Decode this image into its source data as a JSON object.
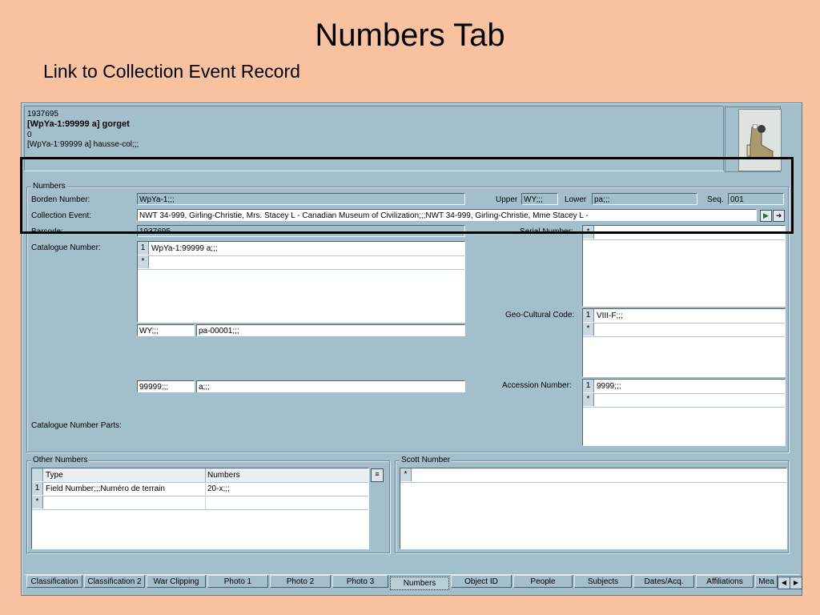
{
  "slide": {
    "title": "Numbers Tab",
    "subtitle": "Link to Collection Event Record"
  },
  "header": {
    "line1": "1937695",
    "line2": "[WpYa-1:99999 a] gorget",
    "line3": "0",
    "line4": "[WpYa-1:99999 a] hausse-col;;;"
  },
  "numbers": {
    "group_label": "Numbers",
    "borden_label": "Borden Number:",
    "borden_value": "WpYa-1;;;",
    "upper_label": "Upper",
    "upper_value": "WY;;;",
    "lower_label": "Lower",
    "lower_value": "pa;;;",
    "seq_label": "Seq.",
    "seq_value": "001",
    "collection_event_label": "Collection Event:",
    "collection_event_value": "NWT 34-999, Girling-Christie, Mrs. Stacey L - Canadian Museum of Civilization;;;NWT 34-999, Girling-Christie, Mme Stacey L -",
    "barcode_label": "Barcode:",
    "barcode_value": "1937695",
    "catalogue_label": "Catalogue Number:",
    "catalogue_rows": [
      {
        "idx": "1",
        "value": "WpYa-1:99999 a;;;"
      }
    ],
    "new_row_marker": "*",
    "part1_a": "WY;;;",
    "part1_b": "pa-00001;;;",
    "part2_a": "99999;;;",
    "part2_b": "a;;;",
    "catalogue_parts_label": "Catalogue Number Parts:",
    "serial_label": "Serial Number:",
    "geo_label": "Geo-Cultural Code:",
    "geo_rows": [
      {
        "idx": "1",
        "value": "VIII-F;;;"
      }
    ],
    "accession_label": "Accession Number:",
    "accession_rows": [
      {
        "idx": "1",
        "value": "9999;;;"
      }
    ]
  },
  "other_numbers": {
    "group_label": "Other Numbers",
    "col_type": "Type",
    "col_numbers": "Numbers",
    "rows": [
      {
        "idx": "1",
        "type": "Field Number;;;Numéro de terrain",
        "numbers": "20-x;;;"
      }
    ]
  },
  "scott": {
    "group_label": "Scott Number"
  },
  "tabs": [
    {
      "label": "Classification"
    },
    {
      "label": "Classification 2"
    },
    {
      "label": "War Clipping"
    },
    {
      "label": "Photo 1"
    },
    {
      "label": "Photo 2"
    },
    {
      "label": "Photo 3"
    },
    {
      "label": "Numbers"
    },
    {
      "label": "Object ID"
    },
    {
      "label": "People"
    },
    {
      "label": "Subjects"
    },
    {
      "label": "Dates/Acq."
    },
    {
      "label": "Affiliations"
    },
    {
      "label": "Mea"
    }
  ],
  "active_tab": "Numbers",
  "icons": {
    "collection_btn_1": "go-icon",
    "collection_btn_2": "next-icon",
    "column_chooser": "column-chooser-icon",
    "tab_left": "scroll-left-icon",
    "tab_right": "scroll-right-icon"
  }
}
